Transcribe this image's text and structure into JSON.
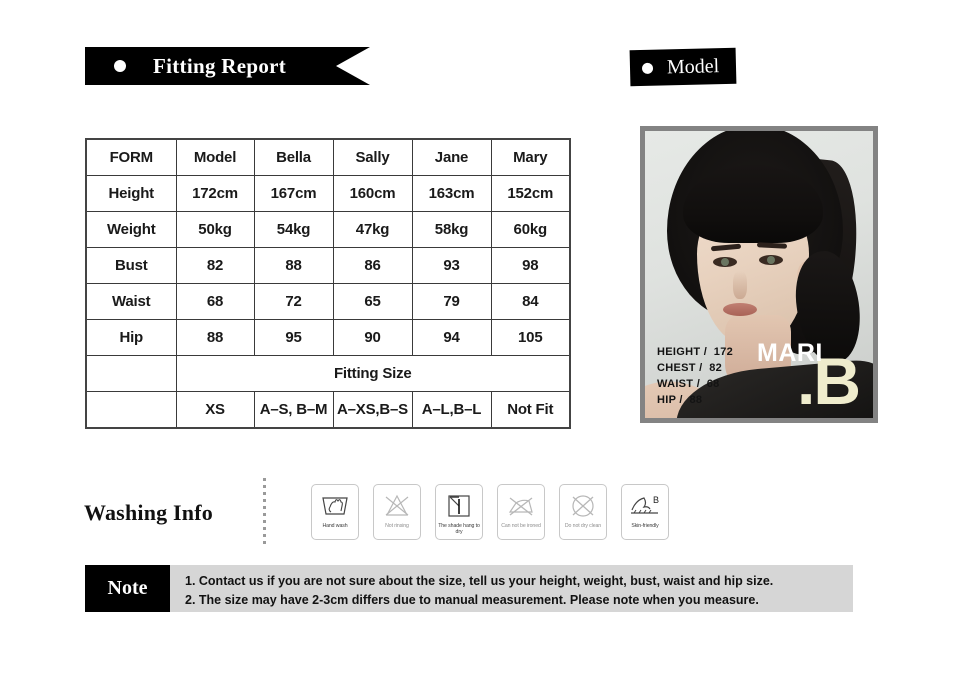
{
  "fitting_report": {
    "title": "Fitting Report",
    "bullet_icon": "circle-bullet-icon"
  },
  "model_section": {
    "title": "Model",
    "bullet_icon": "circle-bullet-icon",
    "photo": {
      "alt": "model-portrait",
      "brand_primary": "MARI",
      "brand_secondary": ".B",
      "stats": [
        "HEIGHT /  172",
        "CHEST /  82",
        "WAIST /  68",
        "HIP /  88"
      ]
    }
  },
  "size_table": {
    "columns": [
      "FORM",
      "Model",
      "Bella",
      "Sally",
      "Jane",
      "Mary"
    ],
    "rows": [
      {
        "label": "Height",
        "values": [
          "172cm",
          "167cm",
          "160cm",
          "163cm",
          "152cm"
        ]
      },
      {
        "label": "Weight",
        "values": [
          "50kg",
          "54kg",
          "47kg",
          "58kg",
          "60kg"
        ]
      },
      {
        "label": "Bust",
        "values": [
          "82",
          "88",
          "86",
          "93",
          "98"
        ]
      },
      {
        "label": "Waist",
        "values": [
          "68",
          "72",
          "65",
          "79",
          "84"
        ]
      },
      {
        "label": "Hip",
        "values": [
          "88",
          "95",
          "90",
          "94",
          "105"
        ]
      }
    ],
    "fitting_size_label": "Fitting Size",
    "fitting_sizes": [
      "XS",
      "A–S, B–M",
      "A–XS,B–S",
      "A–L,B–L",
      "Not Fit"
    ],
    "blank_label": ""
  },
  "washing_info": {
    "title": "Washing Info",
    "icons": [
      {
        "name": "hand-wash-icon",
        "caption": "Hand wash",
        "muted": false
      },
      {
        "name": "no-rinsing-icon",
        "caption": "Not rinsing",
        "muted": true
      },
      {
        "name": "shade-hang-dry-icon",
        "caption": "The shade hang to dry",
        "muted": false
      },
      {
        "name": "no-iron-icon",
        "caption": "Can not be ironed",
        "muted": true
      },
      {
        "name": "no-dry-clean-icon",
        "caption": "Do not dry clean",
        "muted": true
      },
      {
        "name": "skin-friendly-icon",
        "caption": "Skin-friendly",
        "muted": false
      }
    ]
  },
  "note": {
    "label": "Note",
    "line1": "1. Contact us if you are not sure about the size, tell us your height, weight, bust, waist and hip size.",
    "line2": "2. The size may have 2-3cm differs due to manual measurement. Please note when you measure."
  },
  "colors": {
    "banner_black": "#000000",
    "header_gray": "#919191",
    "model_col_gray": "#c7c7c7",
    "note_gray": "#d6d6d6",
    "brand_cream": "#efeccd"
  }
}
